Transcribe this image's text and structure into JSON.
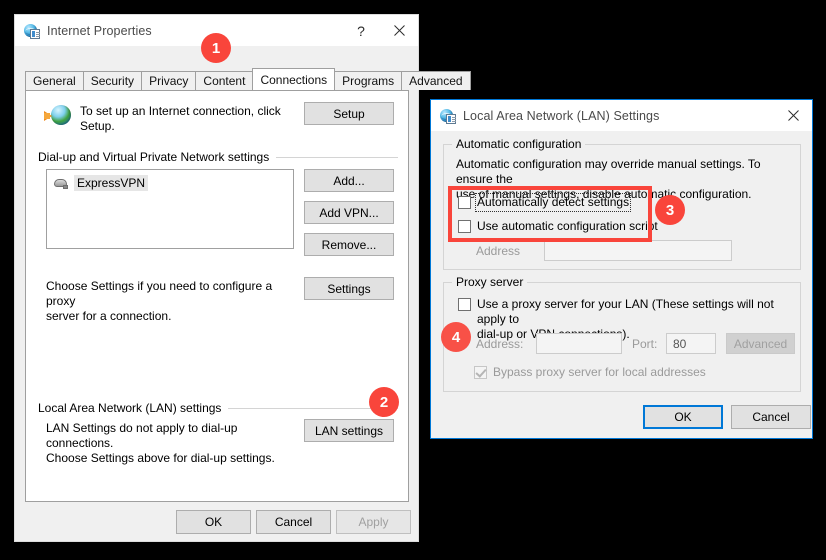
{
  "internet_properties": {
    "title": "Internet Properties",
    "icon": "internet-properties-icon",
    "help_label": "?",
    "close_label": "✕",
    "tabs": [
      {
        "label": "General",
        "active": false
      },
      {
        "label": "Security",
        "active": false
      },
      {
        "label": "Privacy",
        "active": false
      },
      {
        "label": "Content",
        "active": false
      },
      {
        "label": "Connections",
        "active": true
      },
      {
        "label": "Programs",
        "active": false
      },
      {
        "label": "Advanced",
        "active": false
      }
    ],
    "setup_text": "To set up an Internet connection, click\nSetup.",
    "setup_button": "Setup",
    "dialup_section": "Dial-up and Virtual Private Network settings",
    "vpn_list": [
      {
        "name": "ExpressVPN",
        "selected": true
      }
    ],
    "add_button": "Add...",
    "add_vpn_button": "Add VPN...",
    "remove_button": "Remove...",
    "settings_hint": "Choose Settings if you need to configure a proxy\nserver for a connection.",
    "settings_button": "Settings",
    "lan_section": "Local Area Network (LAN) settings",
    "lan_hint": "LAN Settings do not apply to dial-up connections.\nChoose Settings above for dial-up settings.",
    "lan_settings_button": "LAN settings",
    "ok_button": "OK",
    "cancel_button": "Cancel",
    "apply_button": "Apply"
  },
  "lan_settings": {
    "title": "Local Area Network (LAN) Settings",
    "icon": "internet-properties-icon",
    "close_label": "✕",
    "automatic_configuration": {
      "legend": "Automatic configuration",
      "description": "Automatic configuration may override manual settings.  To ensure the\nuse of manual settings, disable automatic configuration.",
      "auto_detect_label": "Automatically detect settings",
      "auto_detect_checked": false,
      "use_script_label": "Use automatic configuration script",
      "use_script_checked": false,
      "address_label": "Address",
      "address_value": "",
      "address_enabled": false
    },
    "proxy_server": {
      "legend": "Proxy server",
      "use_proxy_label": "Use a proxy server for your LAN (These settings will not apply to\ndial-up or VPN connections).",
      "use_proxy_checked": false,
      "address_label": "Address:",
      "address_value": "",
      "port_label": "Port:",
      "port_value": "80",
      "advanced_button": "Advanced",
      "bypass_label": "Bypass proxy server for local addresses",
      "bypass_checked": true
    },
    "ok_button": "OK",
    "cancel_button": "Cancel"
  },
  "annotations": {
    "accent_color": "#f9453b",
    "badges": [
      {
        "number": "1"
      },
      {
        "number": "2"
      },
      {
        "number": "3"
      },
      {
        "number": "4"
      }
    ]
  }
}
